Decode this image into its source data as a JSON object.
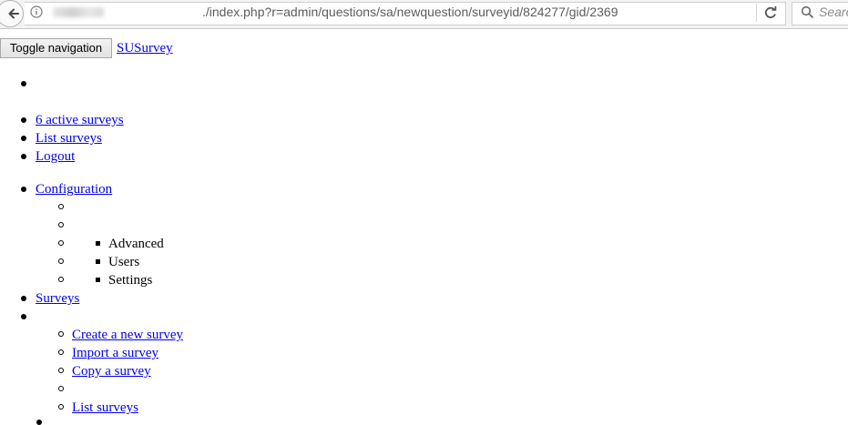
{
  "browser": {
    "url_path": "./index.php?r=admin/questions/sa/newquestion/surveyid/824277/gid/2369",
    "search_placeholder": "Search"
  },
  "navbar": {
    "toggle_label": "Toggle navigation",
    "brand": "SUSurvey"
  },
  "user_menu": {
    "active_surveys": "6 active surveys",
    "list_surveys": "List surveys",
    "logout": "Logout"
  },
  "main_menu": {
    "configuration": {
      "label": "Configuration",
      "submenu": [
        "Advanced",
        "Users",
        "Settings"
      ]
    },
    "surveys": {
      "label": "Surveys",
      "items": [
        "Create a new survey",
        "Import a survey",
        "Copy a survey",
        "List surveys"
      ]
    }
  }
}
